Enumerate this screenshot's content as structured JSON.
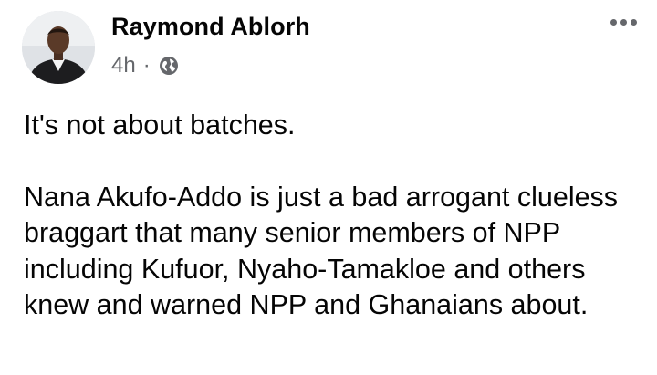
{
  "post": {
    "author": "Raymond Ablorh",
    "time": "4h",
    "separator": "·",
    "privacy_icon": "globe-icon",
    "menu_icon": "more-options-icon",
    "text_line1": "It's not about batches.",
    "text_para2": "Nana Akufo-Addo is just a bad arrogant clueless braggart that many senior members of NPP including Kufuor, Nyaho-Tamakloe and others knew and warned NPP and Ghanaians about."
  },
  "colors": {
    "text": "#050505",
    "secondary": "#65676b"
  }
}
